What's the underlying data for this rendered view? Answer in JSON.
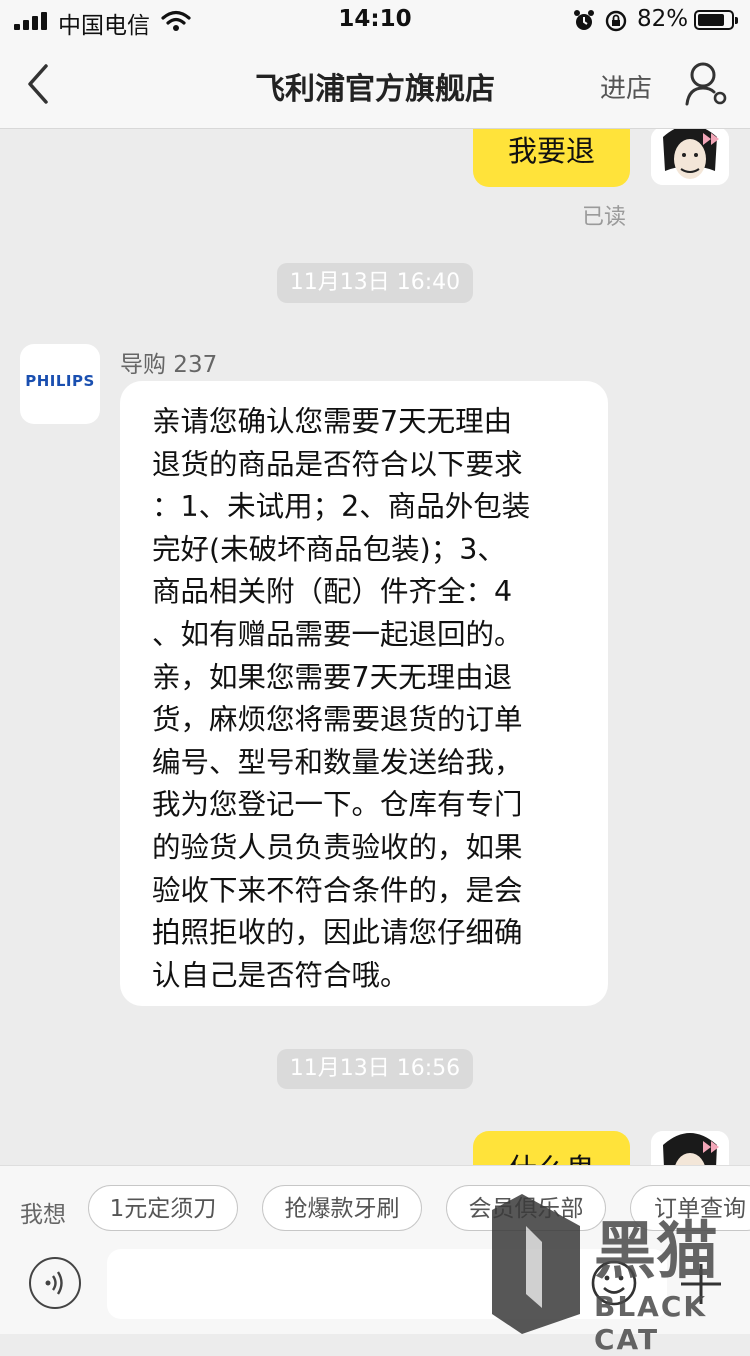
{
  "status_bar": {
    "carrier": "中国电信",
    "time": "14:10",
    "battery_percent": "82%",
    "battery_level": 0.82,
    "icons": [
      "signal-icon",
      "wifi-icon",
      "alarm-icon",
      "rotation-lock-icon",
      "battery-icon"
    ]
  },
  "nav": {
    "title": "飞利浦官方旗舰店",
    "enter_store": "进店",
    "icons": [
      "back-icon",
      "user-icon"
    ]
  },
  "messages": [
    {
      "side": "me",
      "text": "我要退",
      "status": "已读"
    },
    {
      "type": "timestamp",
      "text": "11月13日 16:40"
    },
    {
      "side": "agent",
      "avatar_text": "PHILIPS",
      "sender": "导购 237",
      "lines": [
        "亲请您确认您需要7天无理由",
        "退货的商品是否符合以下要求",
        "：1、未试用；2、商品外包装",
        "完好(未破坏商品包装)；3、",
        "商品相关附（配）件齐全：4",
        "、如有赠品需要一起退回的。",
        "亲，如果您需要7天无理由退",
        "货，麻烦您将需要退货的订单",
        "编号、型号和数量发送给我，",
        "我为您登记一下。仓库有专门",
        "的验货人员负责验收的，如果",
        "验收下来不符合条件的，是会",
        "拍照拒收的，因此请您仔细确",
        "认自己是否符合哦。"
      ]
    },
    {
      "type": "timestamp",
      "text": "11月13日 16:56"
    },
    {
      "side": "me",
      "text": "什么鬼"
    }
  ],
  "quick_bar": {
    "label": "我想",
    "chips": [
      "1元定须刀",
      "抢爆款牙刷",
      "会员俱乐部",
      "订单查询"
    ]
  },
  "input_bar": {
    "icons": [
      "voice-icon",
      "emoji-icon",
      "plus-icon"
    ]
  },
  "watermark": {
    "cn": "黑猫",
    "en": "BLACK CAT"
  },
  "colors": {
    "chat_background": "#ececec",
    "my_bubble": "#ffe33a",
    "agent_bubble": "#ffffff",
    "philips_blue": "#1a4fb0",
    "timestamp_pill": "#dadada"
  }
}
